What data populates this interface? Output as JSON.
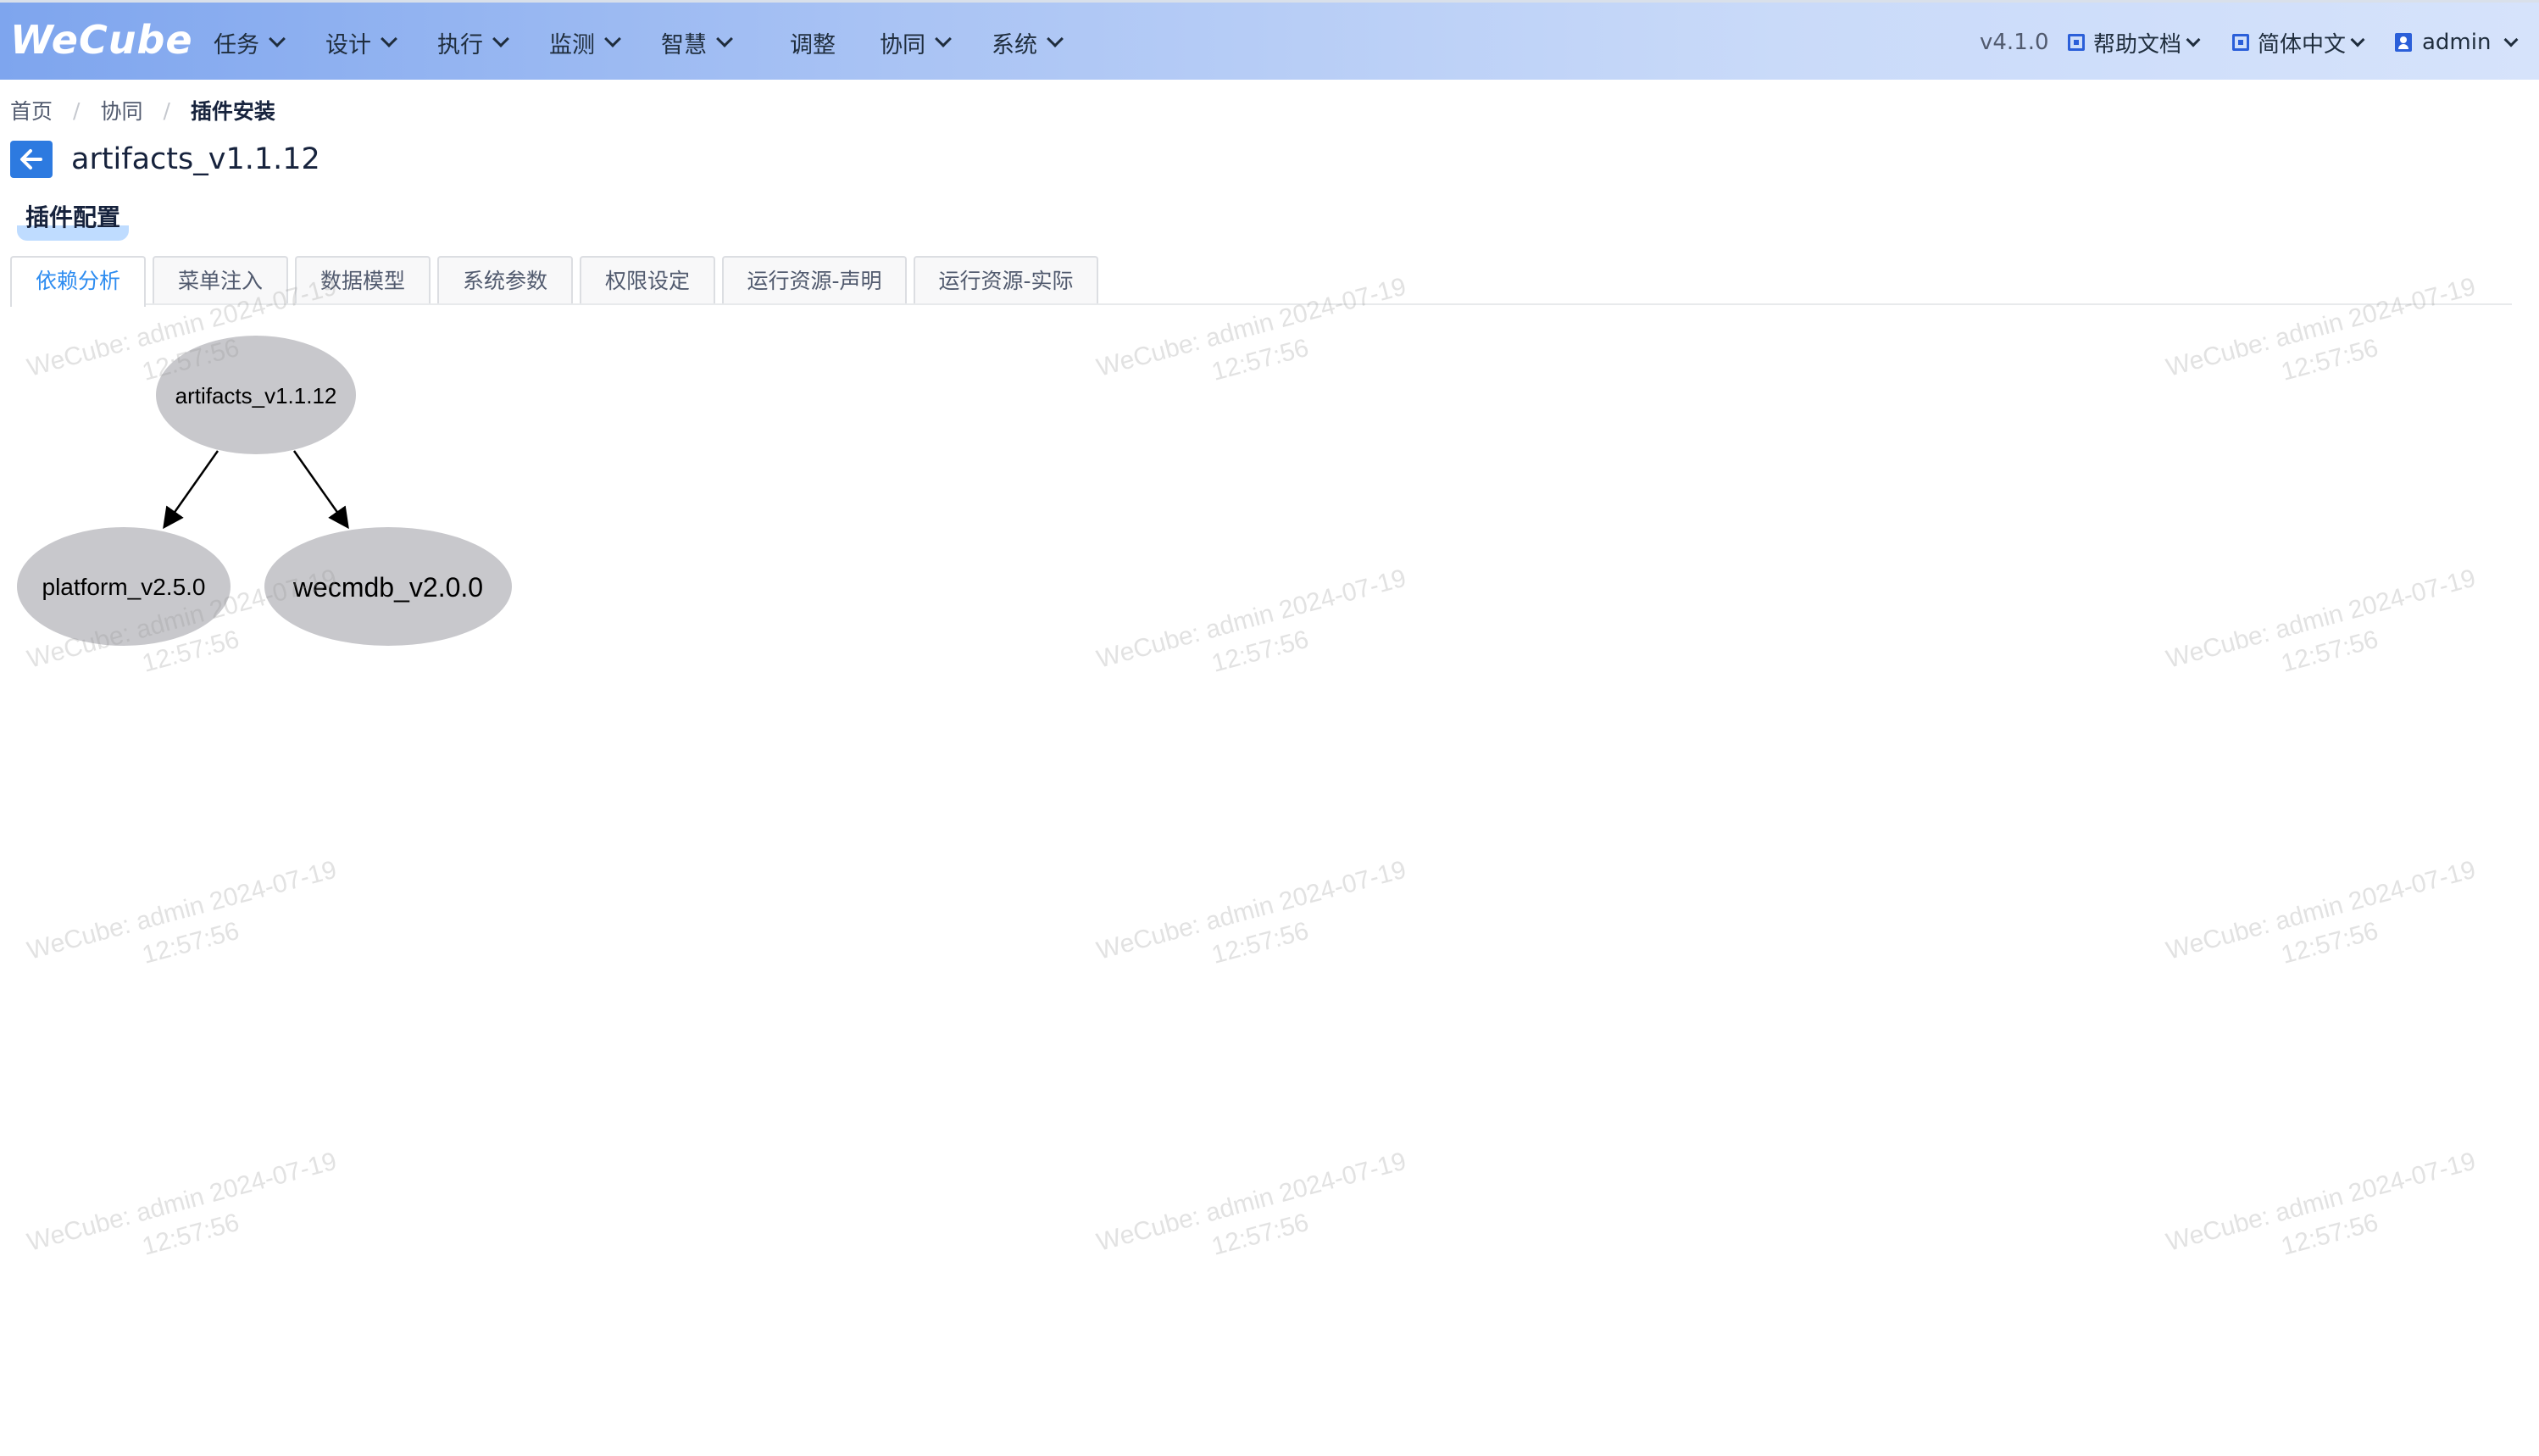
{
  "header": {
    "logo": "WeCube",
    "nav": [
      {
        "label": "任务",
        "has_dropdown": true
      },
      {
        "label": "设计",
        "has_dropdown": true
      },
      {
        "label": "执行",
        "has_dropdown": true
      },
      {
        "label": "监测",
        "has_dropdown": true
      },
      {
        "label": "智慧",
        "has_dropdown": true
      },
      {
        "label": "调整",
        "has_dropdown": false
      },
      {
        "label": "协同",
        "has_dropdown": true
      },
      {
        "label": "系统",
        "has_dropdown": true
      }
    ],
    "version": "v4.1.0",
    "help_docs": "帮助文档",
    "language": "简体中文",
    "user": "admin"
  },
  "breadcrumb": {
    "items": [
      "首页",
      "协同"
    ],
    "current": "插件安装"
  },
  "page": {
    "title": "artifacts_v1.1.12",
    "section_label": "插件配置"
  },
  "tabs": [
    {
      "label": "依赖分析",
      "active": true
    },
    {
      "label": "菜单注入",
      "active": false
    },
    {
      "label": "数据模型",
      "active": false
    },
    {
      "label": "系统参数",
      "active": false
    },
    {
      "label": "权限设定",
      "active": false
    },
    {
      "label": "运行资源-声明",
      "active": false
    },
    {
      "label": "运行资源-实际",
      "active": false
    }
  ],
  "dependency_graph": {
    "root": "artifacts_v1.1.12",
    "dependencies": [
      "platform_v2.5.0",
      "wecmdb_v2.0.0"
    ],
    "node_color": "#c8c8cc"
  },
  "watermark": {
    "line1": "WeCube: admin 2024-07-19",
    "line2": "12:57:56"
  }
}
